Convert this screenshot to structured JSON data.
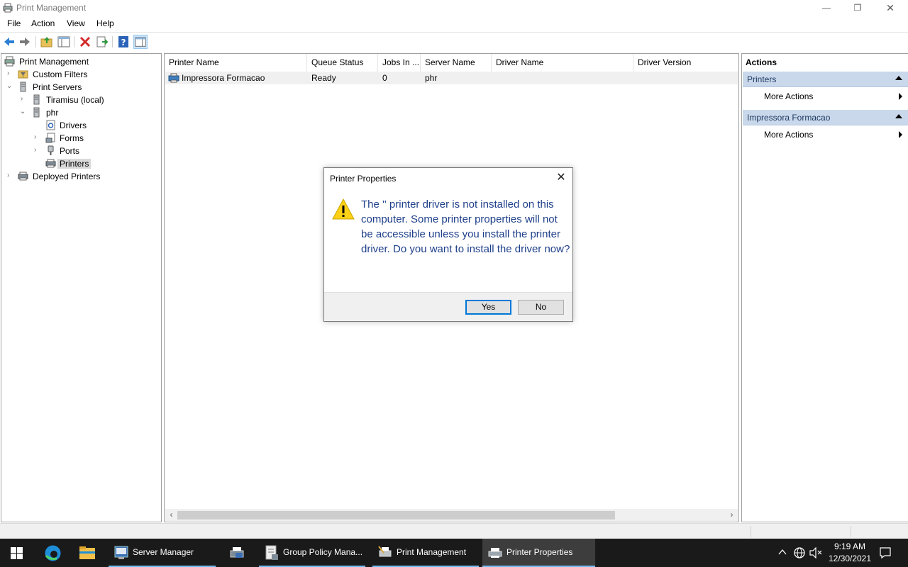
{
  "window": {
    "title": "Print Management",
    "minimize": "—",
    "restore": "❐",
    "close": "✕"
  },
  "menu": [
    "File",
    "Action",
    "View",
    "Help"
  ],
  "tree": {
    "root": "Print Management",
    "custom_filters": "Custom Filters",
    "print_servers": "Print Servers",
    "tiramisu": "Tiramisu (local)",
    "phr": "phr",
    "drivers": "Drivers",
    "forms": "Forms",
    "ports": "Ports",
    "printers": "Printers",
    "deployed_printers": "Deployed Printers"
  },
  "list": {
    "columns": [
      "Printer Name",
      "Queue Status",
      "Jobs In ...",
      "Server Name",
      "Driver Name",
      "Driver Version"
    ],
    "rows": [
      {
        "printer_name": "Impressora Formacao",
        "queue_status": "Ready",
        "jobs": "0",
        "server": "phr",
        "driver_name": "",
        "driver_version": ""
      }
    ]
  },
  "actions": {
    "title": "Actions",
    "sections": [
      {
        "header": "Printers",
        "item": "More Actions"
      },
      {
        "header": "Impressora Formacao",
        "item": "More Actions"
      }
    ]
  },
  "dialog": {
    "title": "Printer Properties",
    "message": "The '' printer driver is not installed on this computer. Some printer properties will not be accessible unless you install the printer driver. Do you want to install the driver now?",
    "yes": "Yes",
    "no": "No"
  },
  "taskbar": {
    "items": [
      "Server Manager",
      "",
      "Group Policy Mana...",
      "Print Management",
      "Printer Properties"
    ],
    "time": "9:19 AM",
    "date": "12/30/2021"
  },
  "colors": {
    "accent": "#0078d7",
    "dialog_text": "#1e3f8a",
    "action_header": "#c9d8ea"
  }
}
